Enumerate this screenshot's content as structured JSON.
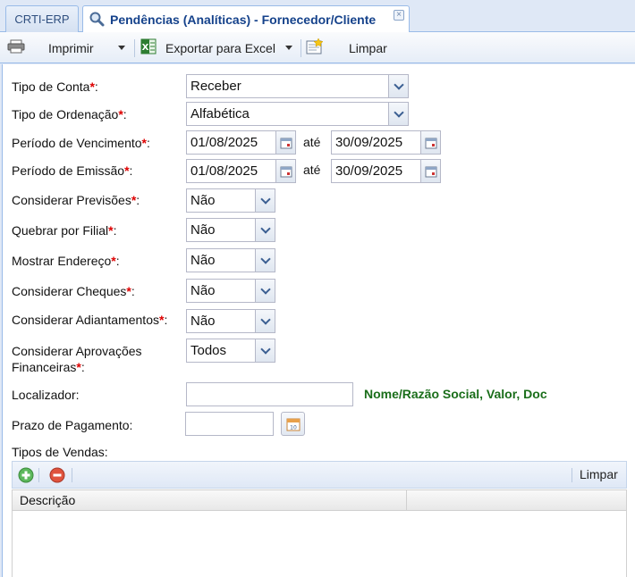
{
  "tabs": {
    "inactive_label": "CRTI-ERP",
    "active_label": "Pendências (Analíticas) - Fornecedor/Cliente",
    "close_glyph": "×"
  },
  "toolbar": {
    "print_label": "Imprimir",
    "export_label": "Exportar para Excel",
    "clear_label": "Limpar"
  },
  "form": {
    "required_marker": "*",
    "tipo_conta": {
      "label": "Tipo de Conta",
      "value": "Receber"
    },
    "tipo_ordenacao": {
      "label": "Tipo de Ordenação",
      "value": "Alfabética"
    },
    "periodo_vencimento": {
      "label": "Período de Vencimento",
      "from": "01/08/2025",
      "to": "30/09/2025"
    },
    "periodo_emissao": {
      "label": "Período de Emissão",
      "from": "01/08/2025",
      "to": "30/09/2025"
    },
    "range_separator": "até",
    "considerar_previsoes": {
      "label": "Considerar Previsões",
      "value": "Não"
    },
    "quebrar_filial": {
      "label": "Quebrar por Filial",
      "value": "Não"
    },
    "mostrar_endereco": {
      "label": "Mostrar Endereço",
      "value": "Não"
    },
    "considerar_cheques": {
      "label": "Considerar Cheques",
      "value": "Não"
    },
    "considerar_adiantamentos": {
      "label": "Considerar Adiantamentos",
      "value": "Não"
    },
    "considerar_aprovacoes": {
      "label_line1": "Considerar Aprovações",
      "label_line2": "Financeiras",
      "value": "Todos"
    },
    "localizador": {
      "label": "Localizador:",
      "value": "",
      "hint": "Nome/Razão Social, Valor, Doc"
    },
    "prazo_pagamento": {
      "label": "Prazo de Pagamento:",
      "value": ""
    },
    "tipos_vendas": {
      "label": "Tipos de Vendas:"
    }
  },
  "grid": {
    "clear_label": "Limpar",
    "columns": [
      "Descrição"
    ]
  },
  "colors": {
    "accent": "#15428b",
    "hint": "#1a6e1a",
    "required": "#dd0000",
    "border": "#99bbe8"
  },
  "icons": {
    "search": "search-icon",
    "printer": "printer-icon",
    "excel": "excel-icon",
    "clear": "clear-icon",
    "calendar": "calendar-icon",
    "add": "add-icon",
    "remove": "remove-icon"
  }
}
